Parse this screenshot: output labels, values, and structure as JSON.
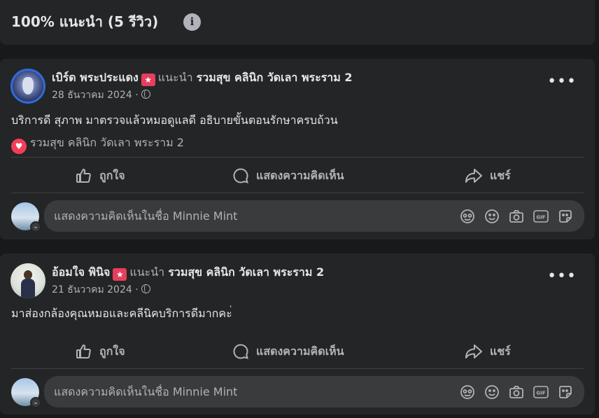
{
  "header": {
    "title": "100% แนะนำ (5 รีวิว)",
    "info_icon": "i"
  },
  "posts": [
    {
      "author": "เบิร์ด พระประแดง",
      "verb": "แนะนำ",
      "page": "รวมสุข คลินิก วัดเลา พระราม 2",
      "date": "28 ธันวาคม 2024 ·",
      "text": "บริการดี สุภาพ มาตรวจแล้วหมอดูแลดี อธิบายขั้นตอนรักษาครบถ้วน",
      "reaction_name": "รวมสุข คลินิก วัดเลา พระราม 2"
    },
    {
      "author": "อ้อมใจ พินิจ",
      "verb": "แนะนำ",
      "page": "รวมสุข คลินิก วัดเลา พระราม 2",
      "date": "21 ธันวาคม 2024 ·",
      "text": "มาส่องกล้องคุณหมอและคลีนิคบริการดีมากคะ่"
    }
  ],
  "actions": {
    "like": "ถูกใจ",
    "comment": "แสดงความคิดเห็น",
    "share": "แชร์"
  },
  "composer": {
    "placeholder": "แสดงความคิดเห็นในชื่อ Minnie Mint",
    "icons": [
      "avatar-sticker-icon",
      "emoji-icon",
      "camera-icon",
      "gif-icon",
      "sticker-icon"
    ]
  },
  "colors": {
    "background": "#18191a",
    "card": "#242526",
    "text": "#e4e6eb",
    "secondary_text": "#b0b3b8",
    "heart": "#f33e58"
  }
}
